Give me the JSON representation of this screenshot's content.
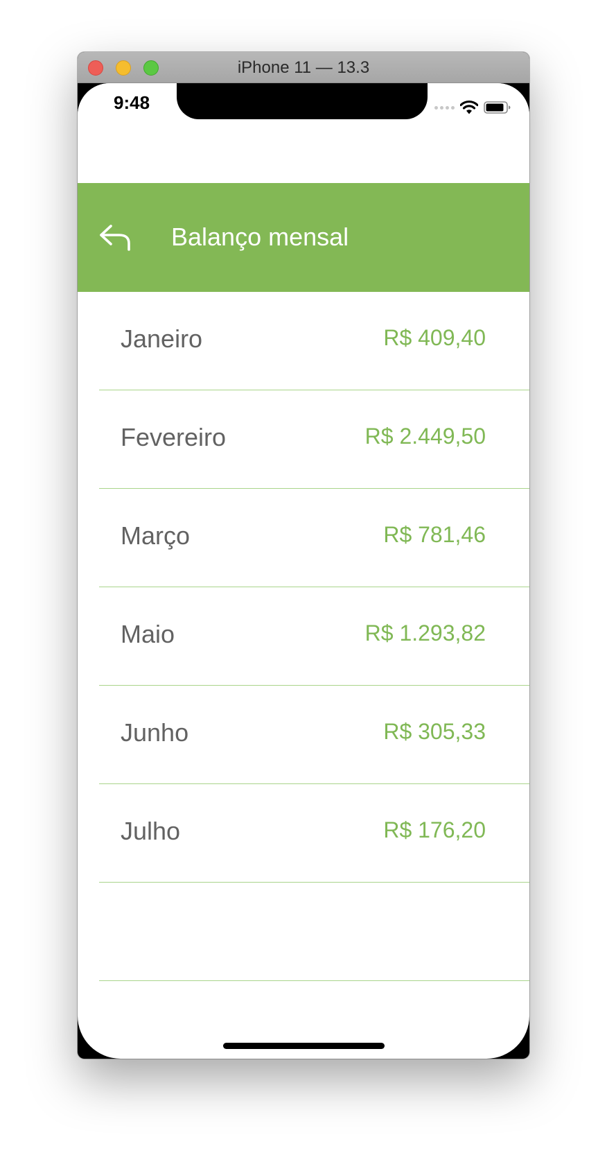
{
  "window": {
    "title": "iPhone 11 — 13.3"
  },
  "status_bar": {
    "time": "9:48",
    "icons": [
      "cellular-signal-icon",
      "wifi-icon",
      "battery-icon"
    ]
  },
  "nav": {
    "title": "Balanço mensal",
    "back_icon": "back-arrow-icon"
  },
  "months": [
    {
      "month": "Janeiro",
      "amount": "R$ 409,40"
    },
    {
      "month": "Fevereiro",
      "amount": "R$ 2.449,50"
    },
    {
      "month": "Março",
      "amount": "R$ 781,46"
    },
    {
      "month": "Maio",
      "amount": "R$ 1.293,82"
    },
    {
      "month": "Junho",
      "amount": "R$ 305,33"
    },
    {
      "month": "Julho",
      "amount": "R$ 176,20"
    }
  ],
  "colors": {
    "accent": "#83b855",
    "amount_text": "#80b855",
    "month_text": "#626262",
    "separator": "#a9d48a"
  }
}
